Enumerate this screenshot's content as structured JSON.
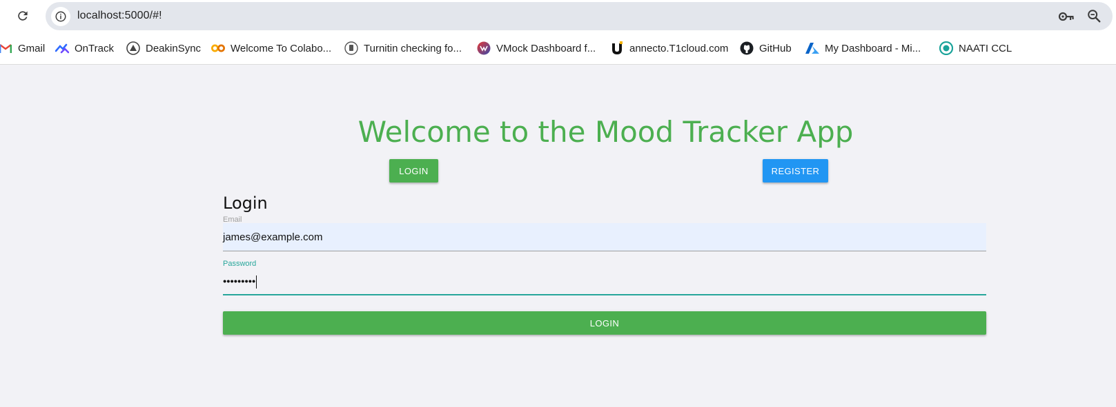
{
  "browser": {
    "url": "localhost:5000/#!",
    "icons": [
      "reload-icon",
      "site-info-icon",
      "password-key-icon",
      "zoom-icon"
    ]
  },
  "bookmarks": [
    {
      "label": "Gmail",
      "icon": "gmail-icon"
    },
    {
      "label": "OnTrack",
      "icon": "ontrack-icon"
    },
    {
      "label": "DeakinSync",
      "icon": "deakinsync-icon"
    },
    {
      "label": "Welcome To Colabo...",
      "icon": "colab-icon"
    },
    {
      "label": "Turnitin checking fo...",
      "icon": "turnitin-icon"
    },
    {
      "label": "VMock Dashboard f...",
      "icon": "vmock-icon"
    },
    {
      "label": "annecto.T1cloud.com",
      "icon": "annecto-icon"
    },
    {
      "label": "GitHub",
      "icon": "github-icon"
    },
    {
      "label": "My Dashboard - Mi...",
      "icon": "azure-icon"
    },
    {
      "label": "NAATI CCL",
      "icon": "naati-icon"
    }
  ],
  "app": {
    "title": "Welcome to the Mood Tracker App",
    "nav": {
      "login_label": "LOGIN",
      "register_label": "REGISTER"
    },
    "form": {
      "heading": "Login",
      "email_label": "Email",
      "email_value": "james@example.com",
      "password_label": "Password",
      "password_value": "•••••••••",
      "submit_label": "LOGIN"
    }
  },
  "colors": {
    "primary_green": "#4caf50",
    "register_blue": "#2196f3",
    "focus_teal": "#26a69a",
    "autofill_bg": "#e8f0fe",
    "page_bg": "#f2f2f6"
  }
}
